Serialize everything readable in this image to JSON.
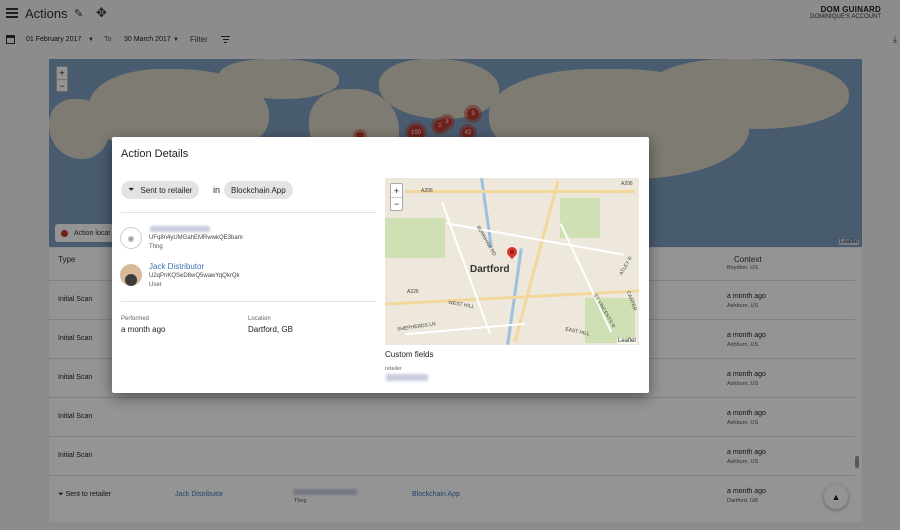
{
  "header": {
    "title": "Actions",
    "user_name": "DOM GUINARD",
    "user_account": "DOMINIQUE'S ACCOUNT"
  },
  "filters": {
    "date_from": "01 February 2017",
    "to_label": "To",
    "date_to": "30 March 2017",
    "filter_label": "Filter"
  },
  "world_map": {
    "zoom_in": "+",
    "zoom_out": "−",
    "clusters": [
      "100",
      "3",
      "3",
      "42",
      "3"
    ],
    "legend": "Action locat",
    "attribution": "Leaflet",
    "marker_color": "#c0392b"
  },
  "table": {
    "columns": {
      "type": "Type",
      "context": "Context"
    },
    "partial_context_sub": "Boydton, US",
    "rows": [
      {
        "type": "Initial Scan",
        "context": "a month ago",
        "context_sub": "Ashburn, US"
      },
      {
        "type": "Initial Scan",
        "context": "a month ago",
        "context_sub": "Ashburn, US"
      },
      {
        "type": "Initial Scan",
        "context": "a month ago",
        "context_sub": "Ashburn, US"
      },
      {
        "type": "Initial Scan",
        "context": "a month ago",
        "context_sub": "Ashburn, US"
      },
      {
        "type": "Initial Scan",
        "context": "a month ago",
        "context_sub": "Ashburn, US"
      }
    ],
    "last_row": {
      "type": "Sent to retailer",
      "user": "Jack Distributor",
      "thng_type": "Thng",
      "app": "Blockchain App",
      "context": "a month ago",
      "context_sub": "Dartford, GB"
    }
  },
  "dialog": {
    "title": "Action Details",
    "action_chip": "Sent to retailer",
    "in_label": "in",
    "app_chip": "Blockchain App",
    "thng": {
      "id": "UFq8n4yUMGahEMRwwkQE3bam",
      "type": "Thng"
    },
    "user": {
      "name": "Jack Distributor",
      "id": "U2qPnKQSeD8wQ5wawYqQkrQk",
      "role": "User"
    },
    "performed_label": "Performed",
    "performed_value": "a month ago",
    "location_label": "Location",
    "location_value": "Dartford, GB",
    "map": {
      "town": "Dartford",
      "zoom_in": "+",
      "zoom_out": "−",
      "attribution": "Leaflet",
      "street_labels": [
        "A206",
        "A206",
        "BURNHAM RD",
        "A226",
        "WEST HILL",
        "SHEPHERDS LN",
        "EAST HILL",
        "ST VINCENTS R",
        "ATLEY R",
        "CANTER"
      ],
      "pin_color": "#d9362b"
    },
    "custom_fields_title": "Custom fields",
    "custom_key": "retailer"
  }
}
